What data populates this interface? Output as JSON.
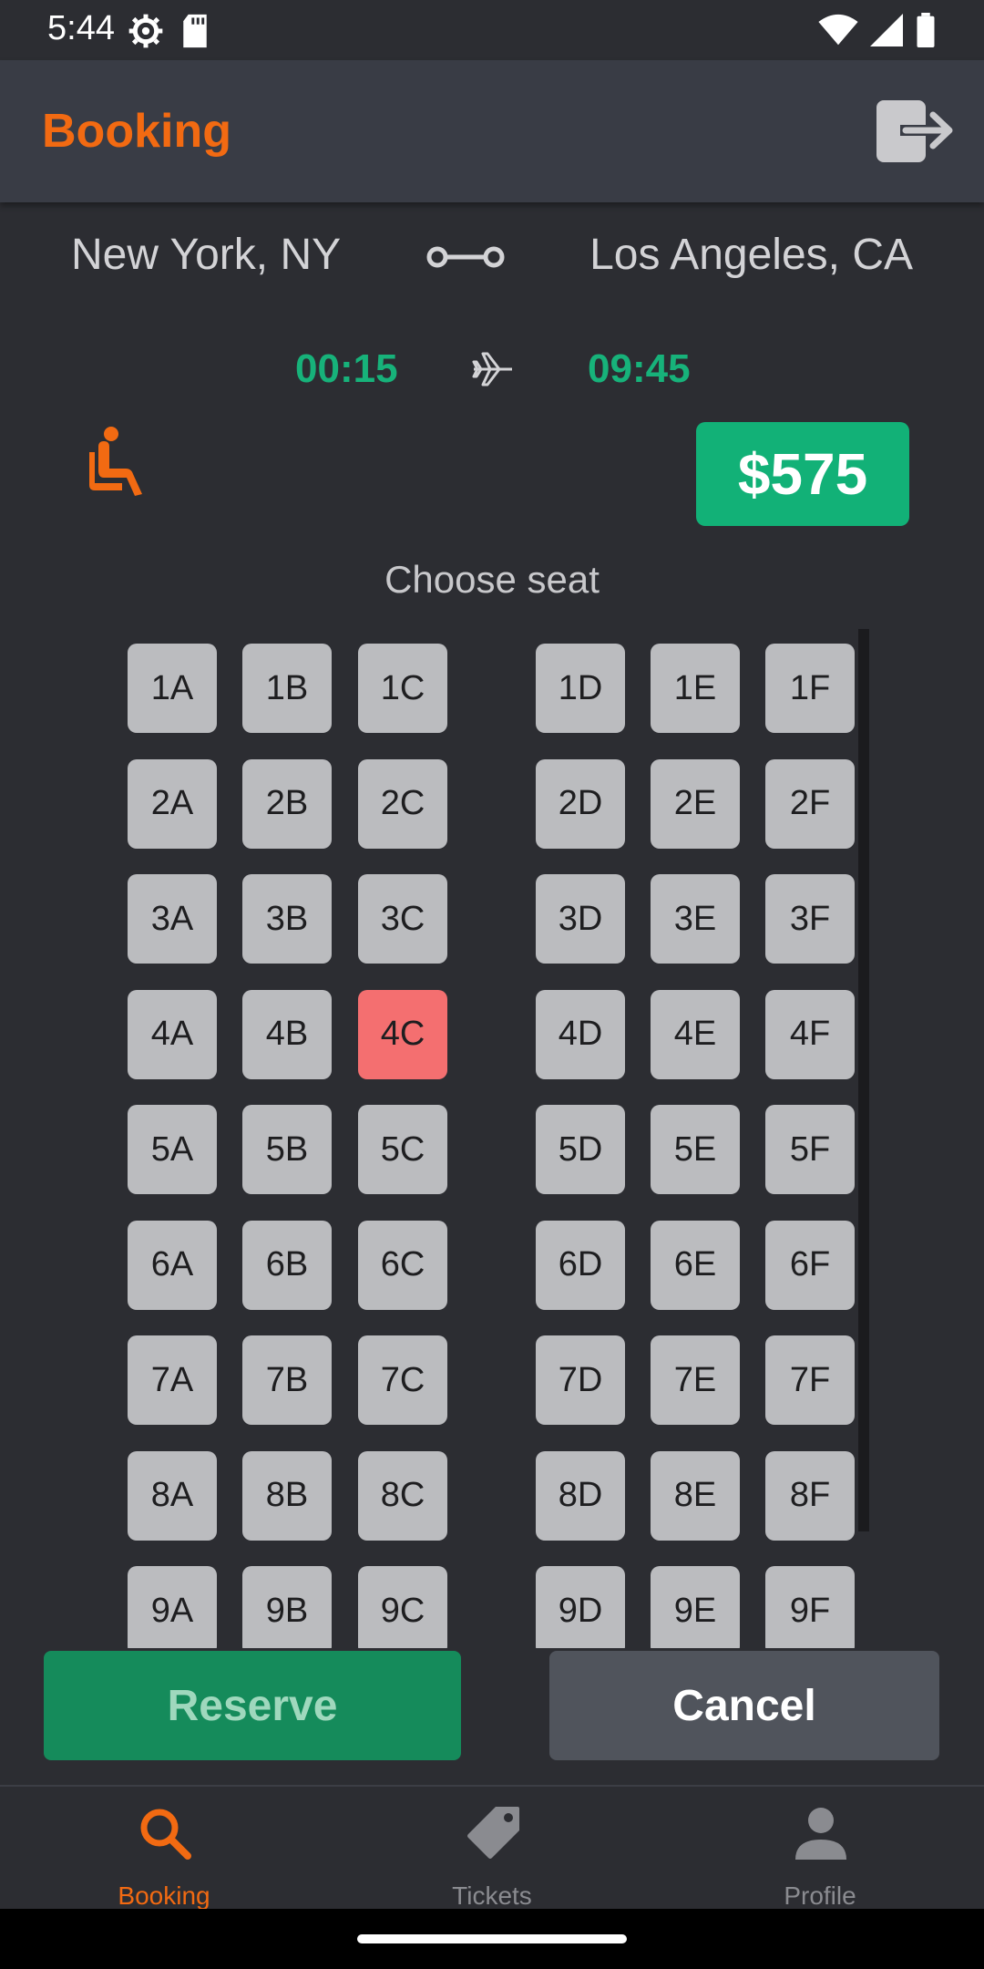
{
  "status": {
    "time": "5:44"
  },
  "header": {
    "title": "Booking"
  },
  "route": {
    "from": "New York, NY",
    "to": "Los Angeles, CA",
    "departure": "00:15",
    "arrival": "09:45"
  },
  "price": "$575",
  "choose_seat_label": "Choose seat",
  "selected_seat": "4C",
  "seats": {
    "rows": [
      "1",
      "2",
      "3",
      "4",
      "5",
      "6",
      "7",
      "8",
      "9"
    ],
    "columns": [
      "A",
      "B",
      "C",
      "D",
      "E",
      "F"
    ]
  },
  "actions": {
    "reserve": "Reserve",
    "cancel": "Cancel"
  },
  "nav": {
    "items": [
      {
        "label": "Booking",
        "icon": "search-icon",
        "active": true
      },
      {
        "label": "Tickets",
        "icon": "ticket-tag-icon",
        "active": false
      },
      {
        "label": "Profile",
        "icon": "person-icon",
        "active": false
      }
    ]
  },
  "colors": {
    "accent": "#f26a12",
    "price_green": "#12b177",
    "selected_seat": "#f46f70",
    "seat": "#bbbcbf"
  }
}
